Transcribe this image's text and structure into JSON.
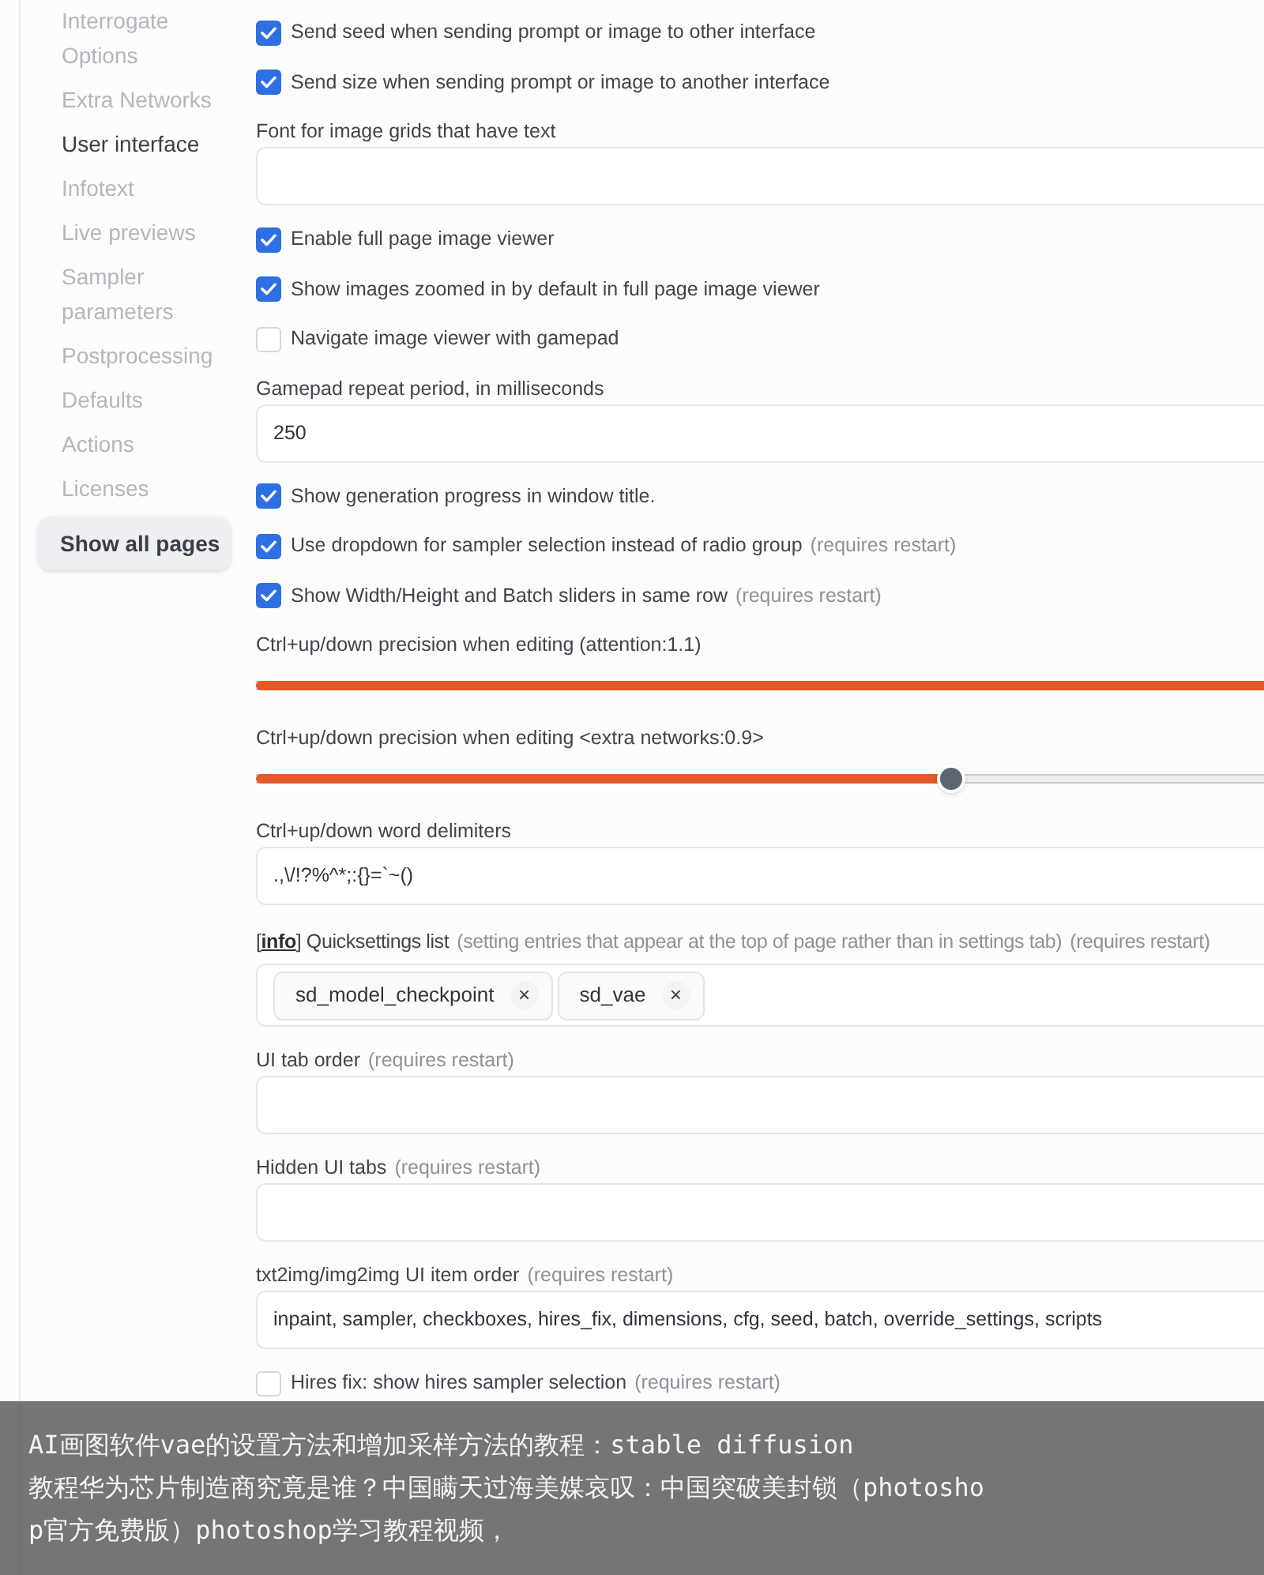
{
  "sidebar": {
    "items": [
      {
        "label": "Interrogate Options",
        "selected": false
      },
      {
        "label": "Extra Networks",
        "selected": false
      },
      {
        "label": "User interface",
        "selected": true
      },
      {
        "label": "Infotext",
        "selected": false
      },
      {
        "label": "Live previews",
        "selected": false
      },
      {
        "label": "Sampler parameters",
        "selected": false
      },
      {
        "label": "Postprocessing",
        "selected": false
      },
      {
        "label": "Defaults",
        "selected": false
      },
      {
        "label": "Actions",
        "selected": false
      },
      {
        "label": "Licenses",
        "selected": false
      }
    ],
    "show_all_button": "Show all pages"
  },
  "settings": [
    {
      "kind": "checkbox",
      "label": "Send seed when sending prompt or image to other interface",
      "checked": true
    },
    {
      "kind": "checkbox",
      "label": "Send size when sending prompt or image to another interface",
      "checked": true
    },
    {
      "kind": "textbox",
      "label": "Font for image grids that have text"
    },
    {
      "kind": "checkbox",
      "label": "Enable full page image viewer",
      "checked": true
    },
    {
      "kind": "checkbox",
      "label": "Show images zoomed in by default in full page image viewer",
      "checked": true
    },
    {
      "kind": "checkbox",
      "label": "Navigate image viewer with gamepad",
      "checked": false
    },
    {
      "kind": "textbox",
      "label": "Gamepad repeat period, in milliseconds",
      "value": "250"
    },
    {
      "kind": "checkbox",
      "label": "Show generation progress in window title.",
      "checked": true
    },
    {
      "kind": "checkbox",
      "label": "Use dropdown for sampler selection instead of radio group",
      "note": "(requires restart)",
      "checked": true
    },
    {
      "kind": "checkbox",
      "label": "Show Width/Height and Batch sliders in same row",
      "note": "(requires restart)",
      "checked": true
    },
    {
      "kind": "slider",
      "label": "Ctrl+up/down precision when editing (attention:1.1)",
      "level": 1
    },
    {
      "kind": "slider",
      "label": "Ctrl+up/down precision when editing <extra networks:0.9>",
      "level": 0.69
    },
    {
      "kind": "textbox",
      "label": "Ctrl+up/down word delimiters",
      "value": ".,\\/!?%^*;:{}=`~()"
    },
    {
      "kind": "multiselect",
      "info_link": {
        "open": "[",
        "text": "info",
        "close": "]"
      },
      "label": "Quicksettings list",
      "hint": "(setting entries that appear at the top of page rather than in settings tab)",
      "note": "(requires restart)",
      "chips": [
        {
          "text": "sd_model_checkpoint",
          "remove": "×"
        },
        {
          "text": "sd_vae",
          "remove": "×"
        }
      ]
    },
    {
      "kind": "textbox",
      "label": "UI tab order",
      "note": "(requires restart)"
    },
    {
      "kind": "textbox",
      "label": "Hidden UI tabs",
      "note": "(requires restart)"
    },
    {
      "kind": "textbox",
      "label": "txt2img/img2img UI item order",
      "note": "(requires restart)",
      "value": "inpaint, sampler, checkboxes, hires_fix, dimensions, cfg, seed, batch, override_settings, scripts"
    },
    {
      "kind": "checkbox",
      "label": "Hires fix: show hires sampler selection",
      "note": "(requires restart)",
      "checked": false
    }
  ],
  "caption": {
    "lines": [
      "AI画图软件vae的设置方法和增加采样方法的教程：stable diffusion",
      "教程华为芯片制造商究竟是谁？中国瞒天过海美媒哀叹：中国突破美封锁（photosho",
      "p官方免费版）photoshop学习教程视频，"
    ]
  }
}
